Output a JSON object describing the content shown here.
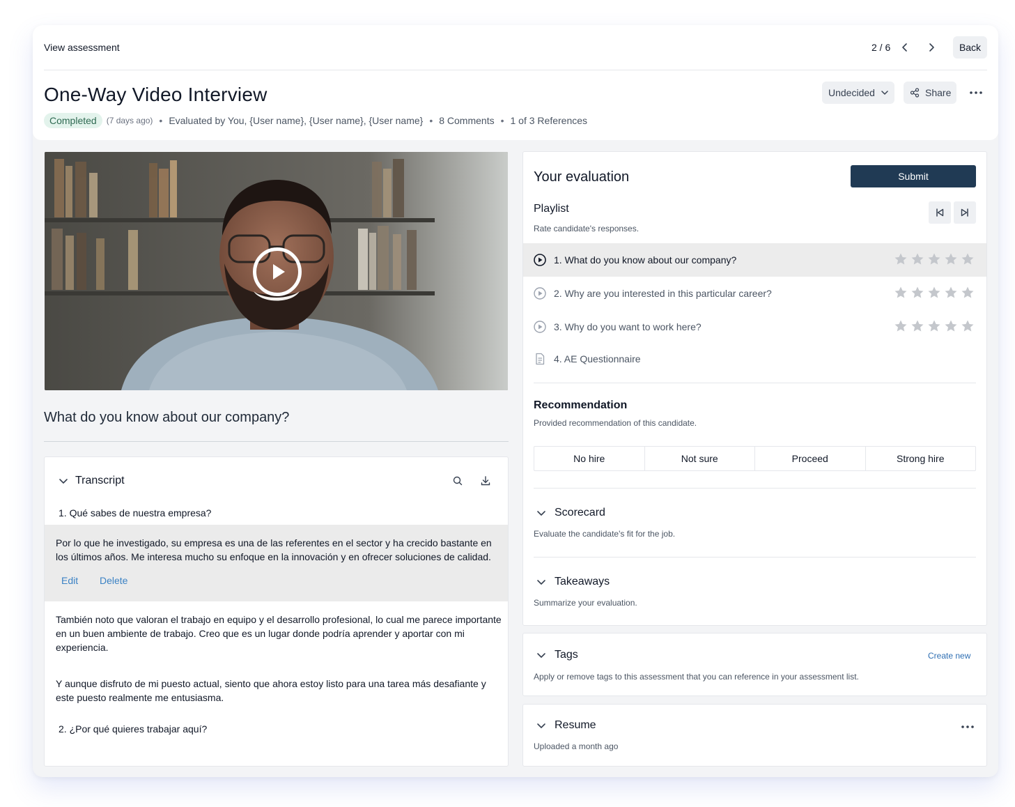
{
  "topbar": {
    "title": "View assessment",
    "pager": "2 / 6",
    "back_label": "Back"
  },
  "header": {
    "title": "One-Way Video Interview",
    "status_badge": "Completed",
    "time_ago": "(7 days ago)",
    "evaluated_by": "Evaluated by You, {User name},  {User name},  {User name}",
    "comments": "8 Comments",
    "references": "1 of 3 References",
    "decision_label": "Undecided",
    "share_label": "Share"
  },
  "video": {
    "question_title": "What do you know about our company?"
  },
  "transcript": {
    "title": "Transcript",
    "q1": "1. Qué sabes de nuestra empresa?",
    "highlight": "Por lo que he investigado, su empresa es una de las referentes en el sector y ha crecido bastante en los últimos años. Me interesa mucho su enfoque en la innovación y en ofrecer soluciones de calidad.",
    "edit_label": "Edit",
    "delete_label": "Delete",
    "p1": "También noto que valoran el trabajo en equipo y el desarrollo profesional, lo cual me parece importante en un buen ambiente de trabajo. Creo que es un lugar donde podría aprender y aportar con mi experiencia.",
    "p2": "Y aunque disfruto de mi puesto actual, siento que ahora estoy listo para una tarea más desafiante y este puesto realmente me entusiasma.",
    "q2": "2. ¿Por qué quieres trabajar aquí?"
  },
  "evaluation": {
    "title": "Your evaluation",
    "submit_label": "Submit",
    "playlist_title": "Playlist",
    "playlist_subtitle": "Rate candidate's responses.",
    "items": [
      {
        "label": "1.  What do you know about our company?",
        "icon": "play-circle-icon",
        "rating": 0
      },
      {
        "label": "2.  Why are you interested in this particular career?",
        "icon": "play-circle-icon",
        "rating": 0
      },
      {
        "label": "3.  Why do you want to work here?",
        "icon": "play-circle-icon",
        "rating": 0
      },
      {
        "label": "4.  AE Questionnaire",
        "icon": "document-icon"
      }
    ],
    "recommendation_title": "Recommendation",
    "recommendation_subtitle": "Provided recommendation of this candidate.",
    "recommendation_options": [
      "No hire",
      "Not sure",
      "Proceed",
      "Strong hire"
    ],
    "scorecard_title": "Scorecard",
    "scorecard_subtitle": "Evaluate the candidate's fit for the job.",
    "takeaways_title": "Takeaways",
    "takeaways_subtitle": "Summarize your evaluation."
  },
  "tags": {
    "title": "Tags",
    "create_label": "Create new",
    "subtitle": "Apply or remove tags to this assessment that you can reference in your assessment list."
  },
  "resume": {
    "title": "Resume",
    "subtitle": "Uploaded a month ago"
  },
  "colors": {
    "accent_dark": "#203a54",
    "link_blue": "#3b82c4",
    "badge_bg": "#e3f3ec",
    "badge_text": "#2f6a52"
  }
}
